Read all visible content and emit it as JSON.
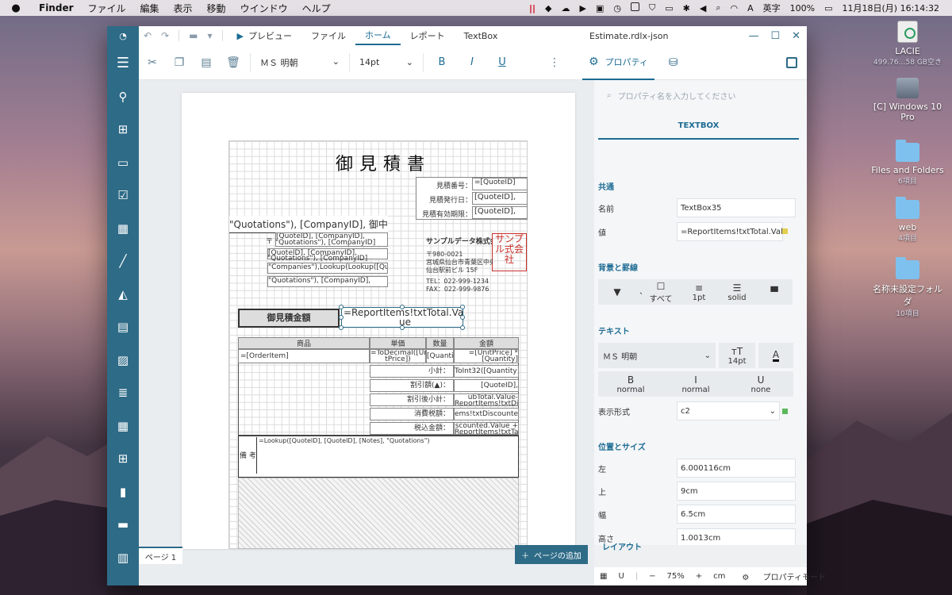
{
  "menubar": {
    "app_name": "Finder",
    "items": [
      "ファイル",
      "編集",
      "表示",
      "移動",
      "ウインドウ",
      "ヘルプ"
    ],
    "input_method": "英字",
    "battery": "100%",
    "datetime": "11月18日(月)  16:14:32"
  },
  "desktop": [
    {
      "label": "LACIE",
      "sub": "499.76…58 GB空き"
    },
    {
      "label": "[C] Windows 10 Pro",
      "sub": ""
    },
    {
      "label": "Files and Folders",
      "sub": "6項目"
    },
    {
      "label": "web",
      "sub": "4項目"
    },
    {
      "label": "名称未設定フォルダ",
      "sub": "10項目"
    }
  ],
  "titlebar": {
    "preview": "プレビュー",
    "tabs": [
      "ファイル",
      "ホーム",
      "レポート",
      "TextBox"
    ],
    "active_tab": "ホーム",
    "doc_title": "Estimate.rdlx-json"
  },
  "ribbon": {
    "font": "ＭＳ 明朝",
    "size": "14pt",
    "bold": "B",
    "italic": "I",
    "underline": "U",
    "properties": "プロパティ"
  },
  "report": {
    "title": "御見積書",
    "meta_labels": [
      "見積番号：",
      "見積発行日：",
      "見積有効期限："
    ],
    "meta_values": [
      "=[QuoteID]",
      "[QuoteID],",
      "[QuoteID],"
    ],
    "customer": "\"Quotations\"), [CompanyID], 御中",
    "addr_lines": [
      "[QuoteID], [CompanyID],",
      "\"Quotations\"), [CompanyID]",
      "[QuoteID], [CompanyID],",
      "\"Quotations\"), [CompanyID]",
      "\"Companies\"),Lookup(Lookup([Quot",
      "\"Quotations\"), [CompanyID],"
    ],
    "postal_mark": "〒",
    "company_name": "サンプルデータ株式会",
    "company_lines": [
      "〒980-0021",
      "宮城県仙台市青葉区中央",
      "仙台駅前ビル 15F"
    ],
    "phone": "TEL：022-999-1234",
    "fax": "FAX：022-999-9876",
    "stamp_text": "サンプル式会社",
    "amount_label": "御見積金額",
    "amount_value": "=ReportItems!txtTotal.Val",
    "amount_value2": "ue",
    "table_headers": [
      "商品",
      "単価",
      "数量",
      "金額"
    ],
    "row_item": "=[OrderItem]",
    "row_price": "=ToDecimal([Uni tPrice])",
    "row_qty": "[Quanti",
    "row_amount": "=[UnitPrice] * [Quantity]",
    "summary_labels": [
      "小計：",
      "割引額(▲)：",
      "割引後小計：",
      "消費税額：",
      "税込金額："
    ],
    "summary_values": [
      "ToInt32([Quantity])",
      "[QuoteID],",
      "ubTotal.Value- ReportItems!txtDis",
      "ems!txtDiscounted",
      "scounted.Value + ReportItems!txtTax"
    ],
    "notes_label": "備 考",
    "notes_value": "=Lookup([QuoteID], [QuoteID], [Notes], \"Quotations\")"
  },
  "status": {
    "page_tab": "ページ 1",
    "add_page": "ページの追加",
    "zoom": "75%",
    "unit": "cm",
    "mode": "プロパティモード"
  },
  "panel": {
    "search_placeholder": "プロパティ名を入力してください",
    "type": "TEXTBOX",
    "sections": {
      "common": "共通",
      "background": "背景と罫線",
      "text": "テキスト",
      "position": "位置とサイズ",
      "layout": "レイアウト"
    },
    "name_label": "名前",
    "name_value": "TextBox35",
    "value_label": "値",
    "value_value": "=ReportItems!txtTotal.Valu",
    "border_all": "すべて",
    "border_width": "1pt",
    "border_style": "solid",
    "font": "ＭＳ 明朝",
    "size": "14pt",
    "font_color_glyph": "A",
    "bold_glyph": "B",
    "bold_value": "normal",
    "italic_glyph": "I",
    "italic_value": "normal",
    "underline_glyph": "U",
    "underline_value": "none",
    "format_label": "表示形式",
    "format_value": "c2",
    "left_label": "左",
    "left_value": "6.000116cm",
    "top_label": "上",
    "top_value": "9cm",
    "width_label": "幅",
    "width_value": "6.5cm",
    "height_label": "高さ",
    "height_value": "1.0013cm"
  },
  "colors": {
    "accent": "#2e6b87",
    "accent_text": "#1d6c93",
    "stamp": "#c9302c",
    "status_yellow": "#e2cf4f",
    "status_green": "#5cb85c"
  }
}
